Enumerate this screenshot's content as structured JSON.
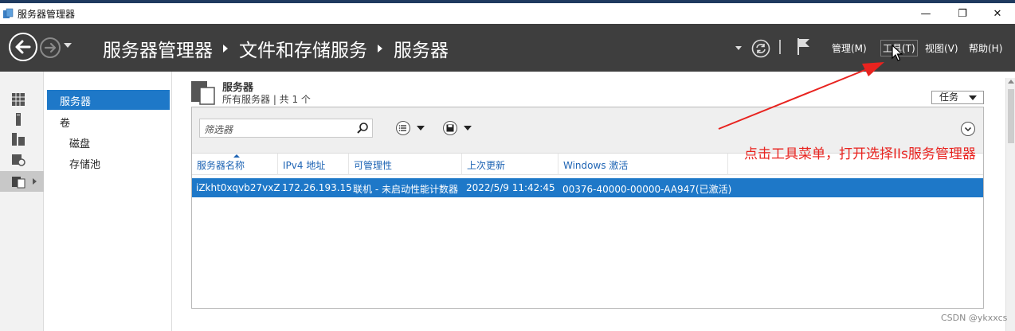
{
  "window": {
    "title": "服务器管理器",
    "minimize_glyph": "—",
    "maximize_glyph": "❐",
    "close_glyph": "✕"
  },
  "header": {
    "breadcrumb": [
      "服务器管理器",
      "文件和存储服务",
      "服务器"
    ],
    "menus": {
      "manage": "管理(M)",
      "tools": "工具(T)",
      "view": "视图(V)",
      "help": "帮助(H)"
    }
  },
  "nav": {
    "items": [
      {
        "label": "服务器",
        "selected": true
      },
      {
        "label": "卷",
        "selected": false
      },
      {
        "label": "磁盘",
        "selected": false
      },
      {
        "label": "存储池",
        "selected": false
      }
    ]
  },
  "section": {
    "title": "服务器",
    "subtitle": "所有服务器 | 共 1 个",
    "tasks_label": "任务"
  },
  "filter": {
    "placeholder": "筛选器"
  },
  "table": {
    "columns": [
      "服务器名称",
      "IPv4 地址",
      "可管理性",
      "上次更新",
      "Windows 激活"
    ],
    "rows": [
      {
        "name": "iZkht0xqvb27vxZ",
        "ipv4": "172.26.193.15",
        "manageability": "联机 - 未启动性能计数器",
        "last_update": "2022/5/9 11:42:45",
        "activation": "00376-40000-00000-AA947(已激活)",
        "selected": true
      }
    ]
  },
  "annotation": {
    "text": "点击工具菜单，打开选择IIs服务管理器",
    "color": "#e8231f"
  },
  "watermark": "CSDN @ykxxcs",
  "colors": {
    "header_bg": "#3e3e3e",
    "selection": "#1e78c8",
    "link_blue": "#1e64b4",
    "annotation_red": "#e8231f"
  }
}
